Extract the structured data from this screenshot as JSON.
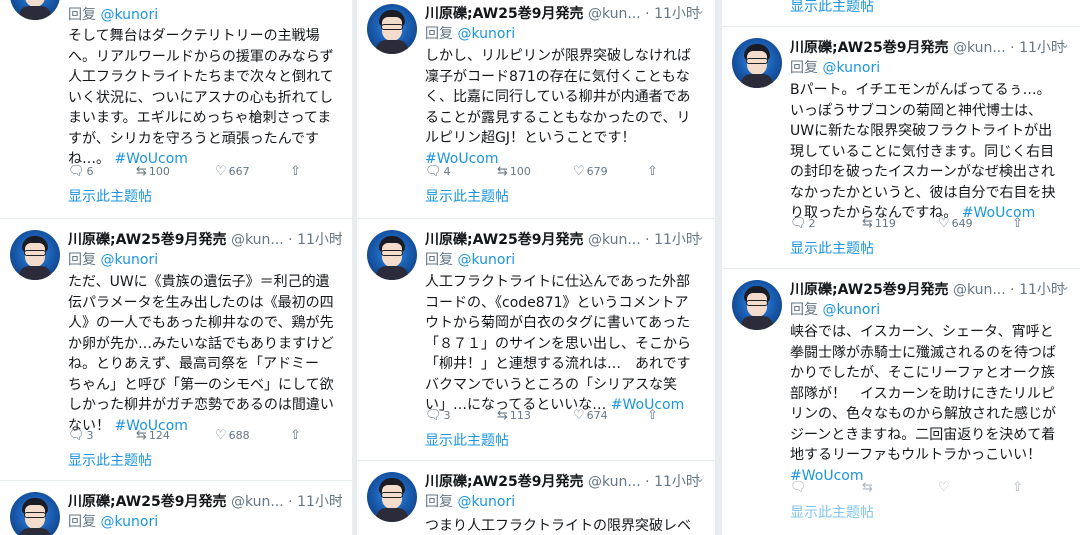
{
  "columns": [
    {
      "tweets": [
        {
          "name": "",
          "handle": "",
          "time": "",
          "reply_prefix": "回复 ",
          "reply_to": "@kunori",
          "lines": [
            "そして舞台はダークテリトリーの主戦場",
            "へ。リアルワールドからの援軍のみならず",
            "人工フラクトライトたちまで次々と倒れて",
            "いく状況に、ついにアスナの心も折れてし",
            "まいます。エギルにめっちゃ槍刺さってま",
            "すが、シリカを守ろうと頑張ったんです"
          ],
          "last_line": "ね…。",
          "hashtag": "#WoUcom",
          "replies": "6",
          "retweets": "100",
          "likes": "667",
          "thread_link": "显示此主题帖"
        },
        {
          "name": "川原礫;AW25巻9月発売",
          "handle": "@kun...",
          "time": "· 11小时",
          "reply_prefix": "回复 ",
          "reply_to": "@kunori",
          "lines": [
            "ただ、UWに《貴族の遺伝子》＝利己的遺",
            "伝パラメータを生み出したのは《最初の四",
            "人》の一人でもあった柳井なので、鶏が先",
            "か卵が先か…みたいな話でもありますけど",
            "ね。とりあえず、最高司祭を「アドミー",
            "ちゃん」と呼び「第一のシモベ」にして欲",
            "しかった柳井がガチ恋勢であるのは間違い"
          ],
          "last_line": "ない！",
          "hashtag": "#WoUcom",
          "replies": "3",
          "retweets": "124",
          "likes": "688",
          "thread_link": "显示此主题帖"
        },
        {
          "name": "川原礫;AW25巻9月発売",
          "handle": "@kun...",
          "time": "· 11小时",
          "reply_prefix": "回复 ",
          "reply_to": "@kunori",
          "lines": [],
          "last_line": "",
          "hashtag": "",
          "replies": "",
          "retweets": "",
          "likes": "",
          "thread_link": ""
        }
      ]
    },
    {
      "tweets": [
        {
          "name": "川原礫;AW25巻9月発売",
          "handle": "@kun...",
          "time": "· 11小时",
          "reply_prefix": "回复 ",
          "reply_to": "@kunori",
          "lines": [
            "しかし、リルピリンが限界突破しなければ",
            "凜子がコード871の存在に気付くこともな",
            "く、比嘉に同行している柳井が内通者であ",
            "ることが露見することもなかったので、リ",
            "ルピリン超GJ！ということです！"
          ],
          "last_line": "",
          "hashtag": "#WoUcom",
          "replies": "4",
          "retweets": "100",
          "likes": "679",
          "thread_link": "显示此主题帖"
        },
        {
          "name": "川原礫;AW25巻9月発売",
          "handle": "@kun...",
          "time": "· 11小时",
          "reply_prefix": "回复 ",
          "reply_to": "@kunori",
          "lines": [
            "人工フラクトライトに仕込んであった外部",
            "コードの、《code871》というコメントア",
            "ウトから菊岡が白衣のタグに書いてあった",
            "「８７１」のサインを思い出し、そこから",
            "「柳井！」と連想する流れは…　あれです",
            "バクマンでいうところの「シリアスな笑",
            "い」…になってるといいな…"
          ],
          "last_line": "",
          "hashtag": "#WoUcom",
          "replies": "3",
          "retweets": "113",
          "likes": "674",
          "thread_link": "显示此主题帖"
        },
        {
          "name": "川原礫;AW25巻9月発売",
          "handle": "@kun...",
          "time": "· 11小时",
          "reply_prefix": "回复 ",
          "reply_to": "@kunori",
          "lines": [
            "つまり人工フラクトライトの限界突破レベ"
          ],
          "last_line": "",
          "hashtag": "",
          "replies": "",
          "retweets": "",
          "likes": "",
          "thread_link": ""
        }
      ]
    },
    {
      "tweets": [
        {
          "name": "",
          "handle": "",
          "time": "",
          "reply_prefix": "",
          "reply_to": "",
          "lines": [],
          "last_line": "",
          "hashtag": "",
          "replies": "",
          "retweets": "",
          "likes": "",
          "thread_link": "显示此主题帖"
        },
        {
          "name": "川原礫;AW25巻9月発売",
          "handle": "@kun...",
          "time": "· 11小时",
          "reply_prefix": "回复 ",
          "reply_to": "@kunori",
          "lines": [
            "Bパート。イチエモンがんばってるぅ…。",
            "いっぽうサブコンの菊岡と神代博士は、",
            "UWに新たな限界突破フラクトライトが出",
            "現していることに気付きます。同じく右目",
            "の封印を破ったイスカーンがなぜ検出され",
            "なかったかというと、彼は自分で右目を抉"
          ],
          "last_line": "り取ったからなんですね。",
          "hashtag": "#WoUcom",
          "replies": "2",
          "retweets": "119",
          "likes": "649",
          "thread_link": "显示此主题帖"
        },
        {
          "name": "川原礫;AW25巻9月発売",
          "handle": "@kun...",
          "time": "· 11小时",
          "reply_prefix": "回复 ",
          "reply_to": "@kunori",
          "lines": [
            "峡谷では、イスカーン、シェータ、宵呼と",
            "拳闘士隊が赤騎士に殲滅されるのを待つば",
            "かりでしたが、そこにリーファとオーク族",
            "部隊が！　イスカーンを助けにきたリルピ",
            "リンの、色々なものから解放された感じが",
            "ジーンときますね。二回宙返りを決めて着",
            "地するリーファもウルトラかっこいい！"
          ],
          "last_line": "",
          "hashtag": "#WoUcom",
          "replies": "",
          "retweets": "",
          "likes": "",
          "thread_link": ""
        }
      ]
    }
  ],
  "thread_link_partial": "显示此主题帖"
}
